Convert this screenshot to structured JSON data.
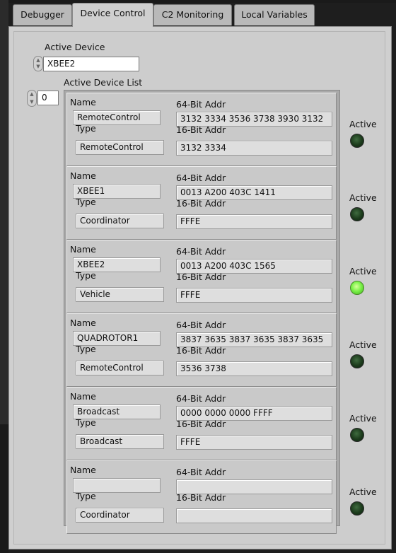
{
  "tabs": [
    {
      "label": "Debugger",
      "active": false
    },
    {
      "label": "Device Control",
      "active": true
    },
    {
      "label": "C2 Monitoring",
      "active": false
    },
    {
      "label": "Local Variables",
      "active": false
    }
  ],
  "active_device": {
    "label": "Active Device",
    "value": "XBEE2"
  },
  "device_list": {
    "label": "Active Device List",
    "index": "0",
    "field_labels": {
      "name": "Name",
      "type": "Type",
      "addr64": "64-Bit Addr",
      "addr16": "16-Bit Addr",
      "active": "Active"
    },
    "devices": [
      {
        "name": "RemoteControl",
        "type": "RemoteControl",
        "addr64": "3132 3334 3536 3738 3930 3132",
        "addr16": "3132 3334",
        "active": false
      },
      {
        "name": "XBEE1",
        "type": "Coordinator",
        "addr64": "0013 A200 403C 1411",
        "addr16": "FFFE",
        "active": false
      },
      {
        "name": "XBEE2",
        "type": "Vehicle",
        "addr64": "0013 A200 403C 1565",
        "addr16": "FFFE",
        "active": true
      },
      {
        "name": "QUADROTOR1",
        "type": "RemoteControl",
        "addr64": "3837 3635 3837 3635 3837 3635",
        "addr16": "3536 3738",
        "active": false
      },
      {
        "name": "Broadcast",
        "type": "Broadcast",
        "addr64": "0000 0000 0000 FFFF",
        "addr16": "FFFE",
        "active": false
      },
      {
        "name": "",
        "type": "Coordinator",
        "addr64": "",
        "addr16": "",
        "active": false
      }
    ]
  },
  "colors": {
    "panel": "#cfcfcf",
    "led_on": "#7cf24a",
    "led_off": "#1b3a1b"
  }
}
